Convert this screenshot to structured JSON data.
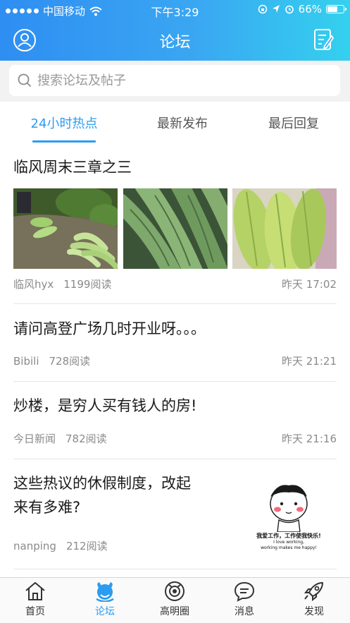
{
  "status_bar": {
    "carrier": "中国移动",
    "time": "下午3:29",
    "battery": "66%",
    "battery_level": 0.66
  },
  "header": {
    "title": "论坛"
  },
  "search": {
    "placeholder": "搜索论坛及帖子"
  },
  "tabs": [
    {
      "label": "24小时热点",
      "active": true
    },
    {
      "label": "最新发布",
      "active": false
    },
    {
      "label": "最后回复",
      "active": false
    }
  ],
  "posts": [
    {
      "title": "临风周末三章之三",
      "author": "临风hyx",
      "reads": "1199阅读",
      "time": "昨天 17:02"
    },
    {
      "title": "请问高登广场几时开业呀。。。",
      "author": "Bibili",
      "reads": "728阅读",
      "time": "昨天 21:21"
    },
    {
      "title": "炒楼，是穷人买有钱人的房!",
      "author": "今日新闻",
      "reads": "782阅读",
      "time": "昨天 21:16"
    },
    {
      "title_line1": "这些热议的休假制度，改起",
      "title_line2": "来有多难?",
      "author": "nanping",
      "reads": "212阅读",
      "thumb_text_1": "我爱工作，工作使我快乐!",
      "thumb_text_2": "I love working,",
      "thumb_text_3": "working makes me happy!"
    }
  ],
  "tabbar": [
    {
      "label": "首页",
      "icon": "home-icon"
    },
    {
      "label": "论坛",
      "icon": "forum-icon",
      "active": true
    },
    {
      "label": "高明圈",
      "icon": "camera-circle-icon"
    },
    {
      "label": "消息",
      "icon": "message-icon"
    },
    {
      "label": "发现",
      "icon": "rocket-icon"
    }
  ],
  "colors": {
    "accent": "#2c9cf0",
    "header_start": "#2e8ef2",
    "header_end": "#34d1ee"
  }
}
